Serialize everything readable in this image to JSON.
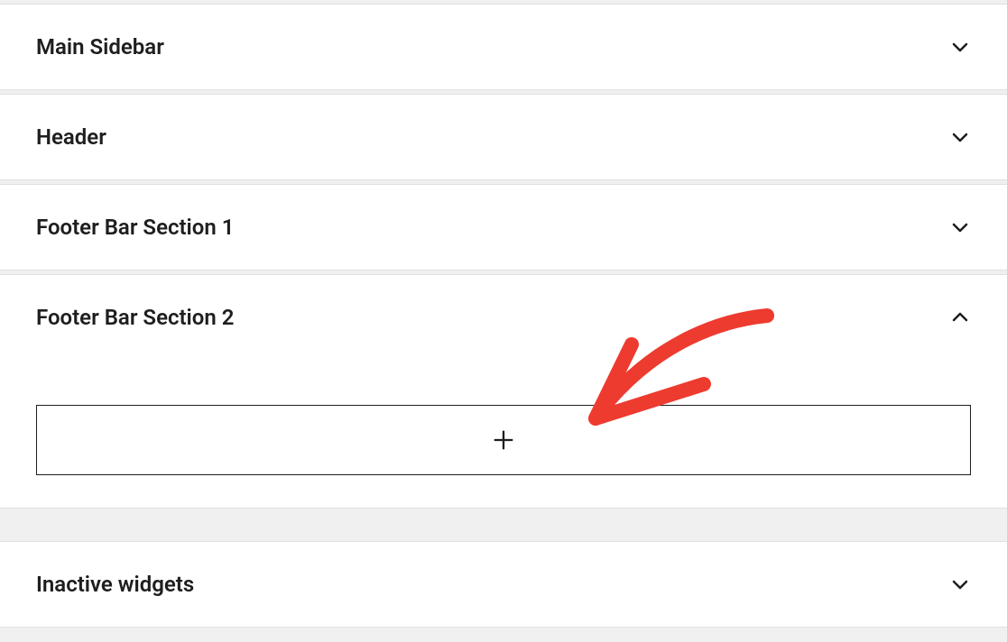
{
  "widget_areas": [
    {
      "title": "Main Sidebar",
      "expanded": false
    },
    {
      "title": "Header",
      "expanded": false
    },
    {
      "title": "Footer Bar Section 1",
      "expanded": false
    },
    {
      "title": "Footer Bar Section 2",
      "expanded": true
    },
    {
      "title": "Inactive widgets",
      "expanded": false
    }
  ],
  "icons": {
    "chevron_down": "chevron-down",
    "chevron_up": "chevron-up",
    "plus": "plus"
  }
}
